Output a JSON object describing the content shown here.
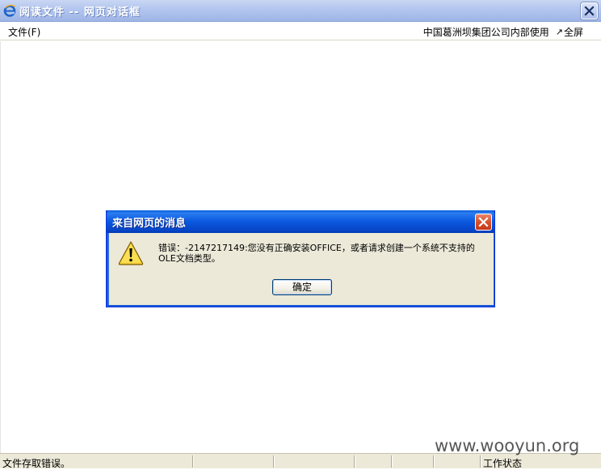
{
  "window": {
    "title": "阅读文件 -- 网页对话框"
  },
  "menubar": {
    "file_menu": "文件(F)",
    "right_text": "中国葛洲坝集团公司内部使用",
    "fullscreen_label": "全屏"
  },
  "message_box": {
    "title": "来自网页的消息",
    "message_line1": "错误：-2147217149:您没有正确安装OFFICE，或者请求创建一个系统不支持的",
    "message_line2": "OLE文档类型。",
    "ok_label": "确定"
  },
  "statusbar": {
    "left_text": "文件存取错误。",
    "right_text": "工作状态"
  },
  "watermark": {
    "text": "www.wooyun.org"
  },
  "colors": {
    "title_bar": "#b4c7ef",
    "dialog_title_bar": "#0a58de",
    "dialog_body": "#ece9d8",
    "close_red": "#d9502b"
  },
  "icons": {
    "title_icon": "ie-icon",
    "close_icon": "close-icon",
    "warning_icon": "warning-icon",
    "fullscreen_icon": "expand-arrow-icon"
  }
}
